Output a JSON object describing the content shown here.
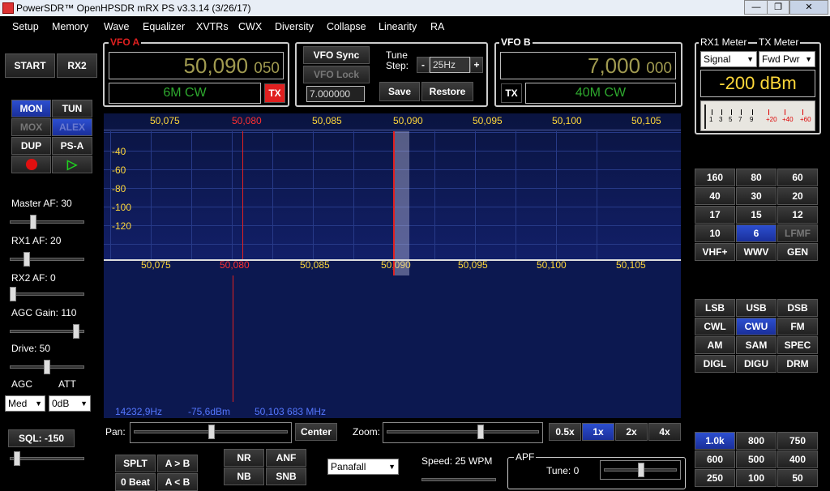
{
  "window": {
    "title": "PowerSDR™ OpenHPSDR mRX PS v3.3.14 (3/26/17)"
  },
  "menu": [
    "Setup",
    "Memory",
    "Wave",
    "Equalizer",
    "XVTRs",
    "CWX",
    "Diversity",
    "Collapse",
    "Linearity",
    "RA"
  ],
  "left": {
    "start": "START",
    "rx2": "RX2",
    "mon": "MON",
    "tun": "TUN",
    "mox": "MOX",
    "alex": "ALEX",
    "dup": "DUP",
    "psa": "PS-A",
    "master_af": "Master AF:  30",
    "rx1_af": "RX1 AF:  20",
    "rx2_af": "RX2 AF:  0",
    "agc_gain": "AGC Gain:  110",
    "drive": "Drive:  50",
    "agc": "AGC",
    "att": "ATT",
    "agc_value": "Med",
    "att_value": "0dB",
    "sql": "SQL: -150"
  },
  "levels": {
    "master_af": 30,
    "rx1_af": 20,
    "rx2_af": 0,
    "agc_gain": 110,
    "drive": 50,
    "sql": -150
  },
  "vfoa": {
    "label": "VFO A",
    "freq_main": "50,090",
    "freq_sub": "050",
    "mode": "6M CW",
    "tx": "TX"
  },
  "vfomid": {
    "sync": "VFO Sync",
    "lock": "VFO Lock",
    "tune_step_label": "Tune\nStep:",
    "step": "25Hz",
    "minus": "-",
    "plus": "+",
    "freq": "7.000000",
    "save": "Save",
    "restore": "Restore"
  },
  "vfob": {
    "label": "VFO B",
    "freq_main": "7,000",
    "freq_sub": "000",
    "mode": "40M CW",
    "tx": "TX"
  },
  "meter": {
    "rx1": "RX1 Meter",
    "tx": "TX Meter",
    "rx1_sel": "Signal",
    "tx_sel": "Fwd Pwr",
    "reading": "-200 dBm",
    "scale": [
      "1",
      "3",
      "5",
      "7",
      "9",
      "+20",
      "+40",
      "+60"
    ]
  },
  "pan": {
    "freqs": [
      "50,075",
      "50,080",
      "50,085",
      "50,090",
      "50,095",
      "50,100",
      "50,105"
    ],
    "dbs": [
      "-40",
      "-60",
      "-80",
      "-100",
      "-120"
    ]
  },
  "status": {
    "hz": "14232,9Hz",
    "dbm": "-75,6dBm",
    "mhz": "50,103 683 MHz"
  },
  "bands": [
    "160",
    "80",
    "60",
    "40",
    "30",
    "20",
    "17",
    "15",
    "12",
    "10",
    "6",
    "LFMF",
    "VHF+",
    "WWV",
    "GEN"
  ],
  "band_active": "6",
  "modes": [
    "LSB",
    "USB",
    "DSB",
    "CWL",
    "CWU",
    "FM",
    "AM",
    "SAM",
    "SPEC",
    "DIGL",
    "DIGU",
    "DRM"
  ],
  "mode_active": "CWU",
  "filters": [
    "1.0k",
    "800",
    "750",
    "600",
    "500",
    "400",
    "250",
    "100",
    "50"
  ],
  "bottom": {
    "pan": "Pan:",
    "center": "Center",
    "zoom": "Zoom:",
    "z05": "0.5x",
    "z1": "1x",
    "z2": "2x",
    "z4": "4x",
    "splt": "SPLT",
    "atob": "A > B",
    "zbeat": "0 Beat",
    "btoa": "A < B",
    "nr": "NR",
    "anf": "ANF",
    "nb": "NB",
    "snb": "SNB",
    "display": "Panafall",
    "speed": "Speed:  25 WPM",
    "apf": "APF",
    "tune": "Tune:  0"
  },
  "colors": {
    "accent_blue": "#2440c0",
    "tx_red": "#e02020",
    "freq_yellow": "#ffd83a",
    "vfo_green": "#2ea82e"
  }
}
